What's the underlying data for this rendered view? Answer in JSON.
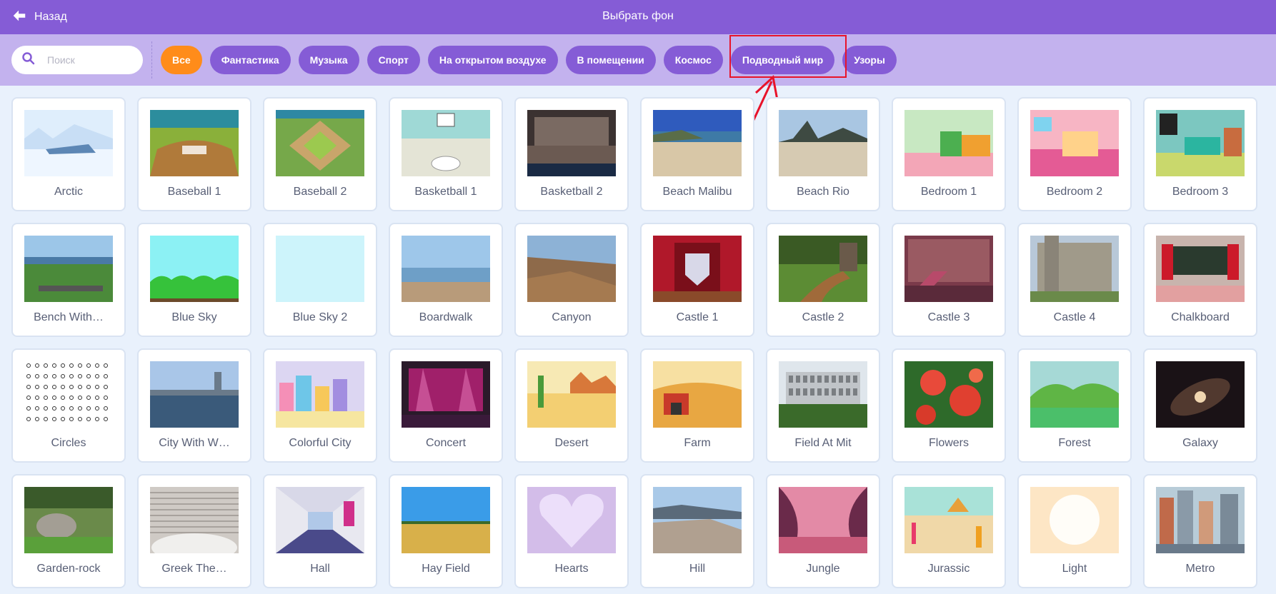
{
  "header": {
    "back_label": "Назад",
    "title": "Выбрать фон"
  },
  "search": {
    "placeholder": "Поиск"
  },
  "tags": [
    {
      "label": "Все",
      "active": true
    },
    {
      "label": "Фантастика"
    },
    {
      "label": "Музыка"
    },
    {
      "label": "Спорт"
    },
    {
      "label": "На открытом воздухе"
    },
    {
      "label": "В помещении"
    },
    {
      "label": "Космос"
    },
    {
      "label": "Подводный мир",
      "highlighted": true
    },
    {
      "label": "Узоры"
    }
  ],
  "backdrops": [
    {
      "label": "Arctic",
      "thumb": "arctic"
    },
    {
      "label": "Baseball 1",
      "thumb": "baseball1"
    },
    {
      "label": "Baseball 2",
      "thumb": "baseball2"
    },
    {
      "label": "Basketball 1",
      "thumb": "basketball1"
    },
    {
      "label": "Basketball 2",
      "thumb": "basketball2"
    },
    {
      "label": "Beach Malibu",
      "thumb": "beach"
    },
    {
      "label": "Beach Rio",
      "thumb": "beachrio"
    },
    {
      "label": "Bedroom 1",
      "thumb": "bedroom1"
    },
    {
      "label": "Bedroom 2",
      "thumb": "bedroom2"
    },
    {
      "label": "Bedroom 3",
      "thumb": "bedroom3"
    },
    {
      "label": "Bench With…",
      "thumb": "bench"
    },
    {
      "label": "Blue Sky",
      "thumb": "bluesky"
    },
    {
      "label": "Blue Sky 2",
      "thumb": "bluesky2"
    },
    {
      "label": "Boardwalk",
      "thumb": "boardwalk"
    },
    {
      "label": "Canyon",
      "thumb": "canyon"
    },
    {
      "label": "Castle 1",
      "thumb": "castle1"
    },
    {
      "label": "Castle 2",
      "thumb": "castle2"
    },
    {
      "label": "Castle 3",
      "thumb": "castle3"
    },
    {
      "label": "Castle 4",
      "thumb": "castle4"
    },
    {
      "label": "Chalkboard",
      "thumb": "chalkboard"
    },
    {
      "label": "Circles",
      "thumb": "circles"
    },
    {
      "label": "City With W…",
      "thumb": "city"
    },
    {
      "label": "Colorful City",
      "thumb": "colorfulcity"
    },
    {
      "label": "Concert",
      "thumb": "concert"
    },
    {
      "label": "Desert",
      "thumb": "desert"
    },
    {
      "label": "Farm",
      "thumb": "farm"
    },
    {
      "label": "Field At Mit",
      "thumb": "field"
    },
    {
      "label": "Flowers",
      "thumb": "flowers"
    },
    {
      "label": "Forest",
      "thumb": "forest"
    },
    {
      "label": "Galaxy",
      "thumb": "galaxy"
    },
    {
      "label": "Garden-rock",
      "thumb": "garden"
    },
    {
      "label": "Greek The…",
      "thumb": "greek"
    },
    {
      "label": "Hall",
      "thumb": "hall"
    },
    {
      "label": "Hay Field",
      "thumb": "hayfield"
    },
    {
      "label": "Hearts",
      "thumb": "hearts"
    },
    {
      "label": "Hill",
      "thumb": "hill"
    },
    {
      "label": "Jungle",
      "thumb": "jungle"
    },
    {
      "label": "Jurassic",
      "thumb": "jurassic"
    },
    {
      "label": "Light",
      "thumb": "light"
    },
    {
      "label": "Metro",
      "thumb": "metro"
    }
  ],
  "colors": {
    "header": "#855cd6",
    "filterbar": "#c3b2ee",
    "active_tag": "#ff8c1a",
    "highlight": "#e8132a"
  }
}
